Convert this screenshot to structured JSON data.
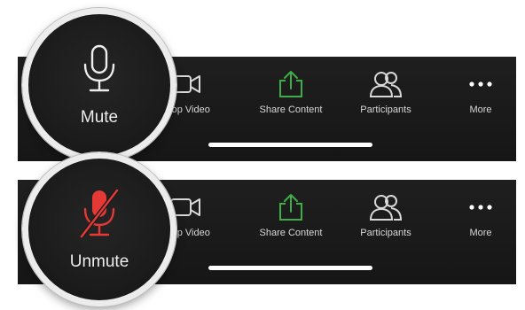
{
  "toolbars": [
    {
      "items": [
        {
          "label": "Stop Video",
          "icon": "video-camera-icon"
        },
        {
          "label": "Share Content",
          "icon": "share-icon"
        },
        {
          "label": "Participants",
          "icon": "participants-icon"
        },
        {
          "label": "More",
          "icon": "more-icon"
        }
      ],
      "magnifier": {
        "label": "Mute",
        "icon": "microphone-icon"
      }
    },
    {
      "items": [
        {
          "label": "Stop Video",
          "icon": "video-camera-icon"
        },
        {
          "label": "Share Content",
          "icon": "share-icon"
        },
        {
          "label": "Participants",
          "icon": "participants-icon"
        },
        {
          "label": "More",
          "icon": "more-icon"
        }
      ],
      "magnifier": {
        "label": "Unmute",
        "icon": "microphone-muted-icon"
      }
    }
  ],
  "colors": {
    "toolbar_bg": "#1a1a1a",
    "icon_default": "#d8d8d8",
    "share_green": "#3fae49",
    "muted_red": "#e53935",
    "magnifier_ring": "#ececec"
  }
}
